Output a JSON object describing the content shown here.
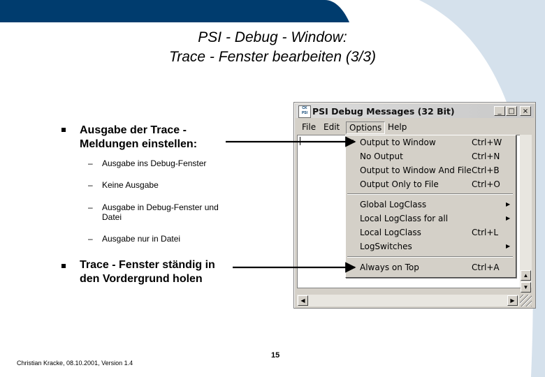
{
  "slide": {
    "title_line1": "PSI - Debug - Window:",
    "title_line2": "Trace - Fenster bearbeiten (3/3)",
    "bullets": [
      {
        "text_line1": "Ausgabe der Trace -",
        "text_line2": "Meldungen einstellen:"
      },
      {
        "text_line1": "Trace - Fenster ständig in",
        "text_line2": "den Vordergrund holen"
      }
    ],
    "subitems": [
      {
        "dash": "–",
        "text_line1": "Ausgabe ins Debug-Fenster"
      },
      {
        "dash": "–",
        "text_line1": "Keine Ausgabe"
      },
      {
        "dash": "–",
        "text_line1": "Ausgabe in Debug-Fenster und",
        "text_line2": "Datei"
      },
      {
        "dash": "–",
        "text_line1": "Ausgabe nur in Datei"
      }
    ],
    "footer": "Christian Kracke, 08.10.2001, Version 1.4",
    "page_number": "15"
  },
  "window": {
    "title": "PSI Debug Messages (32 Bit)",
    "app_icon_text": "CK PSI",
    "minimize_glyph": "_",
    "maximize_glyph": "□",
    "close_glyph": "×",
    "menus": [
      "File",
      "Edit",
      "Options",
      "Help"
    ],
    "options_menu": {
      "group1": [
        {
          "label": "Output to Window",
          "shortcut": "Ctrl+W",
          "checked": true,
          "check_glyph": "✔"
        },
        {
          "label": "No Output",
          "shortcut": "Ctrl+N"
        },
        {
          "label": "Output to Window And File",
          "shortcut": "Ctrl+B"
        },
        {
          "label": "Output Only to File",
          "shortcut": "Ctrl+O"
        }
      ],
      "group2": [
        {
          "label": "Global LogClass",
          "submenu_glyph": "▶"
        },
        {
          "label": "Local LogClass for all",
          "submenu_glyph": "▶"
        },
        {
          "label": "Local LogClass",
          "shortcut": "Ctrl+L"
        },
        {
          "label": "LogSwitches",
          "submenu_glyph": "▶"
        }
      ],
      "group3": [
        {
          "label": "Always on Top",
          "shortcut": "Ctrl+A"
        }
      ]
    },
    "scroll_up_glyph": "▲",
    "scroll_down_glyph": "▼",
    "scroll_left_glyph": "◀",
    "scroll_right_glyph": "▶"
  },
  "colors": {
    "header_band": "#003c6e",
    "header_light": "#c8d8e6",
    "arrow": "#000000"
  }
}
